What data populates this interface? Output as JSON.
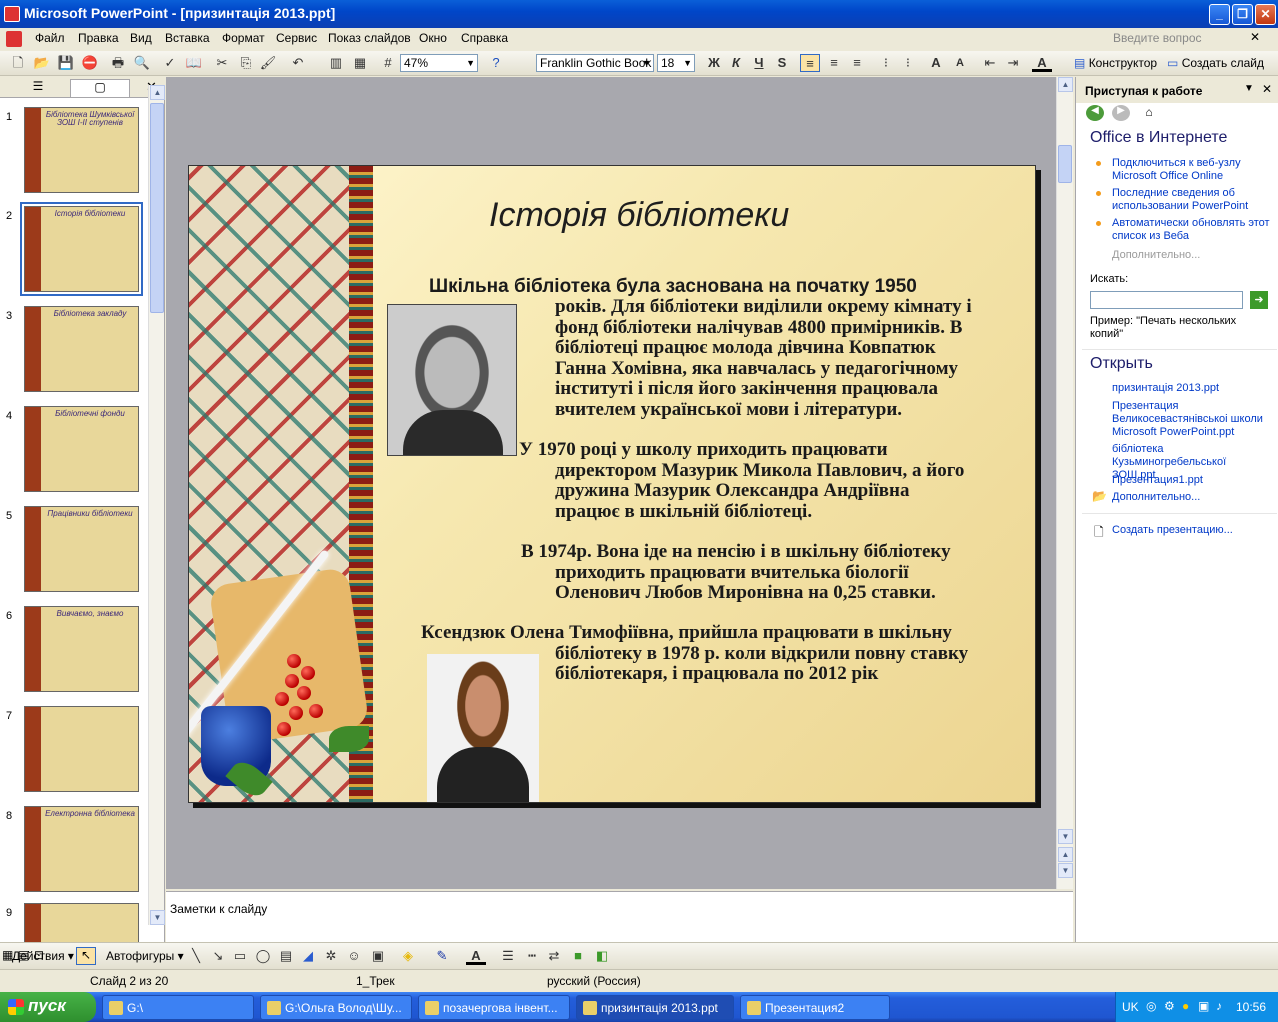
{
  "window": {
    "title": "Microsoft PowerPoint - [призинтація 2013.ppt]"
  },
  "menu": [
    "Файл",
    "Правка",
    "Вид",
    "Вставка",
    "Формат",
    "Сервис",
    "Показ слайдов",
    "Окно",
    "Справка"
  ],
  "ask_placeholder": "Введите вопрос",
  "toolbar": {
    "zoom": "47%",
    "font_name": "Franklin Gothic Book",
    "font_size": "18",
    "bold": "Ж",
    "italic": "К",
    "underline": "Ч",
    "shadow": "S",
    "designer": "Конструктор",
    "new_slide": "Создать слайд"
  },
  "slides_pane": {
    "thumbnails": [
      {
        "num": "1",
        "label": "Бібліотека Шумківської ЗОШ І-ІІ ступенів"
      },
      {
        "num": "2",
        "label": "Історія бібліотеки"
      },
      {
        "num": "3",
        "label": "Бібліотека закладу"
      },
      {
        "num": "4",
        "label": "Бібліотечні фонди"
      },
      {
        "num": "5",
        "label": "Працівники бібліотеки"
      },
      {
        "num": "6",
        "label": "Вивчаємо, знаємо"
      },
      {
        "num": "7",
        "label": ""
      },
      {
        "num": "8",
        "label": "Електронна бібліотека"
      },
      {
        "num": "9",
        "label": ""
      }
    ]
  },
  "slide": {
    "title": "Історія   бібліотеки",
    "p1_line1": "Шкільна бібліотека була заснована на початку 1950",
    "p1_rest": [
      "років. Для бібліотеки виділили окрему кімнату і",
      "фонд бібліотеки налічував 4800 примірників. В",
      "бібліотеці працює молода дівчина Ковпатюк",
      "Ганна Хомівна, яка навчалась у педагогічному",
      "інституті і після його закінчення працювала",
      "вчителем української мови і літератури."
    ],
    "p2": [
      "У 1970 році у школу приходить працювати",
      "директором Мазурик Микола Павлович, а його",
      "дружина Мазурик Олександра Андріївна",
      "працює в шкільній бібліотеці."
    ],
    "p3": [
      "В 1974р. Вона іде на пенсію і в шкільну бібліотеку",
      "приходить працювати вчителька біології",
      "Оленович Любов Миронівна на  0,25 ставки."
    ],
    "p4": [
      "Ксендзюк Олена Тимофіївна, прийшла працювати в шкільну",
      "бібліотеку в 1978 р. коли відкрили повну ставку",
      "бібліотекаря, і працювала по 2012 рік"
    ]
  },
  "notes_placeholder": "Заметки к слайду",
  "task_pane": {
    "header": "Приступая к работе",
    "office_online": "Office в Интернете",
    "links": [
      "Подключиться к веб-узлу Microsoft Office Online",
      "Последние сведения об использовании PowerPoint",
      "Автоматически обновлять этот список из Веба"
    ],
    "more": "Дополнительно...",
    "search_label": "Искать:",
    "example": "Пример:  \"Печать нескольких копий\"",
    "open_header": "Открыть",
    "open_files": [
      "призинтація 2013.ppt",
      "Презентация Великосевастянівськоі школи Microsoft PowerPoint.ppt",
      "бібліотека Кузьминогребельської ЗОШ.ppt",
      "Презентация1.ppt"
    ],
    "open_more": "Дополнительно...",
    "create": "Создать презентацию..."
  },
  "drawbar": {
    "actions": "Действия",
    "autoshapes": "Автофигуры"
  },
  "status": {
    "slide": "Слайд 2 из 20",
    "design": "1_Трек",
    "language": "русский (Россия)"
  },
  "taskbar": {
    "start": "пуск",
    "tasks": [
      "G:\\",
      "G:\\Ольга Волод\\Шу...",
      "позачергова інвент...",
      "призинтація 2013.ppt",
      "Презентация2"
    ],
    "lang": "UK",
    "time": "10:56"
  }
}
